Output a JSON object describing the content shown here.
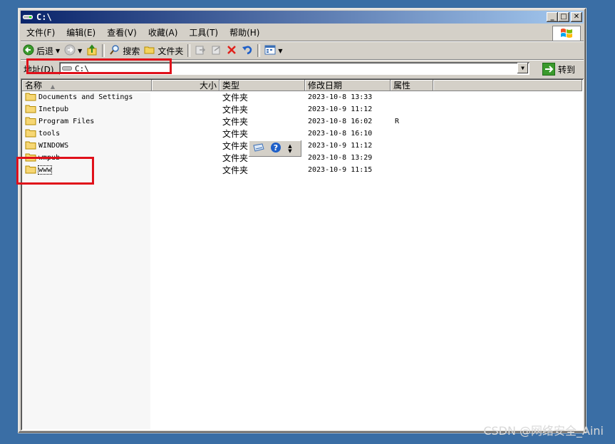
{
  "window": {
    "title": "C:\\"
  },
  "title_buttons": {
    "minimize": "_",
    "maximize": "□",
    "close": "✕"
  },
  "menu": [
    "文件(F)",
    "编辑(E)",
    "查看(V)",
    "收藏(A)",
    "工具(T)",
    "帮助(H)"
  ],
  "toolbar": {
    "back": "后退",
    "search": "搜索",
    "folders": "文件夹"
  },
  "address": {
    "label": "地址(D)",
    "value": "C:\\",
    "go": "转到"
  },
  "columns": {
    "name": "名称",
    "size": "大小",
    "type": "类型",
    "modified": "修改日期",
    "attributes": "属性"
  },
  "files": [
    {
      "name": "Documents and Settings",
      "size": "",
      "type": "文件夹",
      "modified": "2023-10-8 13:33",
      "attr": ""
    },
    {
      "name": "Inetpub",
      "size": "",
      "type": "文件夹",
      "modified": "2023-10-9 11:12",
      "attr": ""
    },
    {
      "name": "Program Files",
      "size": "",
      "type": "文件夹",
      "modified": "2023-10-8 16:02",
      "attr": "R"
    },
    {
      "name": "tools",
      "size": "",
      "type": "文件夹",
      "modified": "2023-10-8 16:10",
      "attr": ""
    },
    {
      "name": "WINDOWS",
      "size": "",
      "type": "文件夹",
      "modified": "2023-10-9 11:12",
      "attr": ""
    },
    {
      "name": "wmpub",
      "size": "",
      "type": "文件夹",
      "modified": "2023-10-8 13:29",
      "attr": ""
    },
    {
      "name": "www",
      "size": "",
      "type": "文件夹",
      "modified": "2023-10-9 11:15",
      "attr": ""
    }
  ],
  "watermark": "CSDN @网络安全_Aini",
  "colors": {
    "desktop": "#3a6ea5",
    "highlight": "#e0101a",
    "title_start": "#0a246a"
  }
}
